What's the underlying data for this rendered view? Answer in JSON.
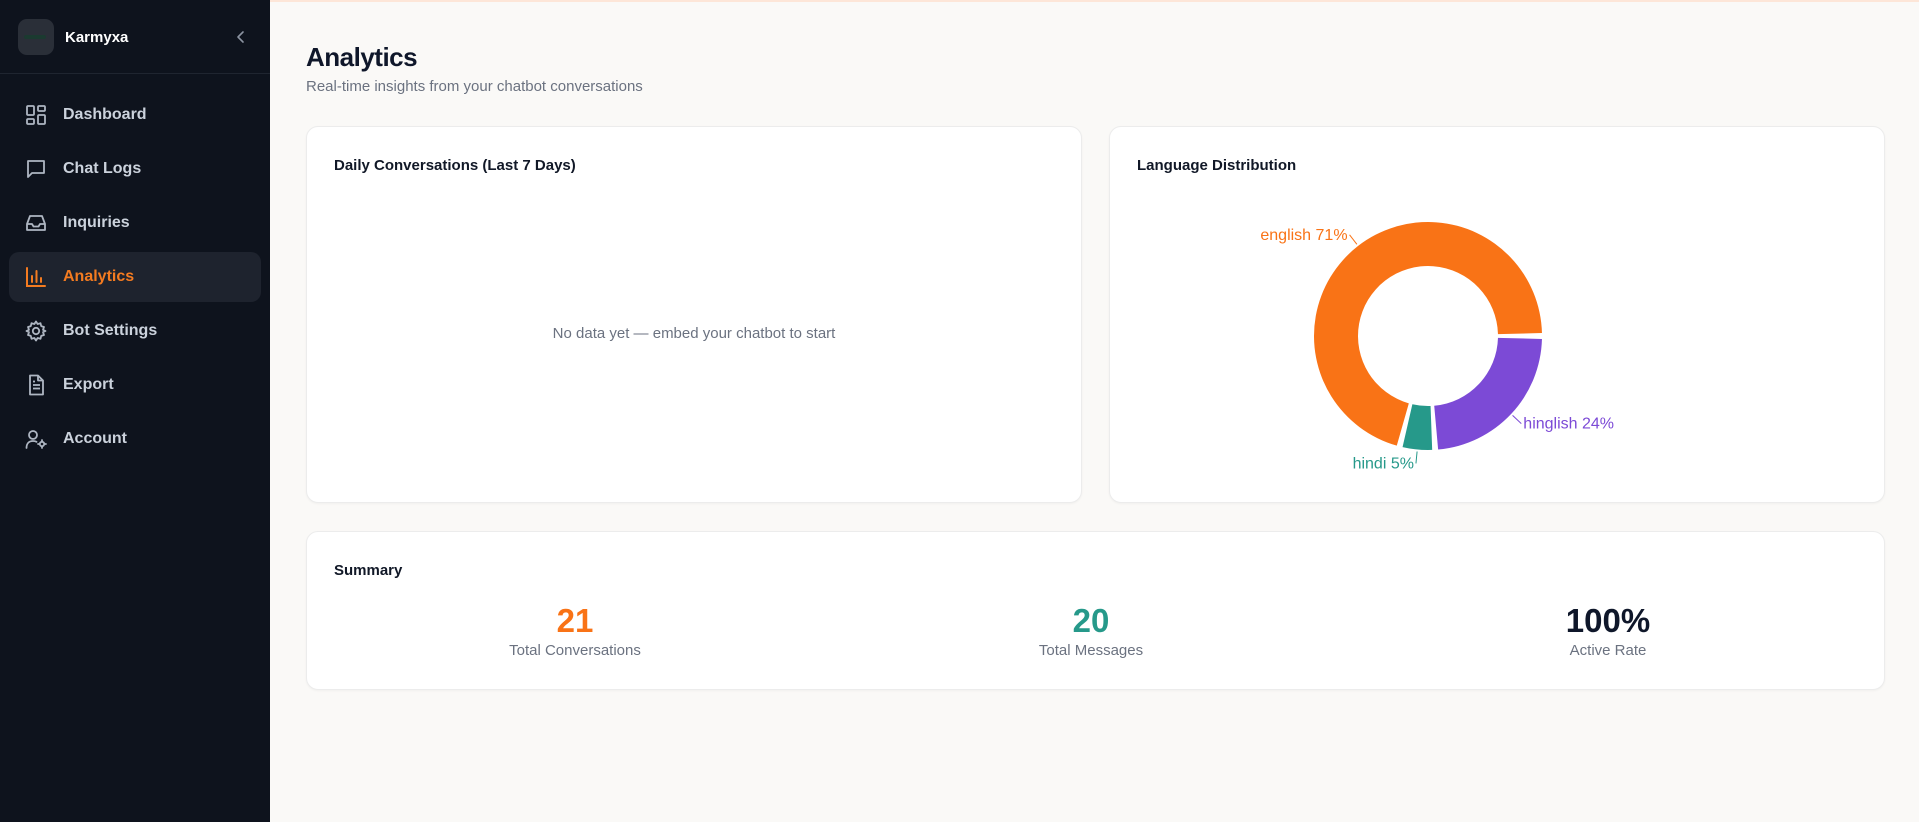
{
  "brand": {
    "name": "Karmyxa"
  },
  "nav": [
    {
      "label": "Dashboard",
      "icon": "dashboard-icon"
    },
    {
      "label": "Chat Logs",
      "icon": "chat-icon"
    },
    {
      "label": "Inquiries",
      "icon": "inbox-icon"
    },
    {
      "label": "Analytics",
      "icon": "bar-chart-icon",
      "active": true
    },
    {
      "label": "Bot Settings",
      "icon": "gear-icon"
    },
    {
      "label": "Export",
      "icon": "file-icon"
    },
    {
      "label": "Account",
      "icon": "user-settings-icon"
    }
  ],
  "header": {
    "title": "Analytics",
    "subtitle": "Real-time insights from your chatbot conversations"
  },
  "daily_card": {
    "title": "Daily Conversations (Last 7 Days)",
    "empty_message": "No data yet — embed your chatbot to start"
  },
  "language_card": {
    "title": "Language Distribution"
  },
  "chart_data": {
    "type": "pie",
    "categories": [
      "english",
      "hinglish",
      "hindi"
    ],
    "values": [
      71,
      24,
      5
    ],
    "labels": [
      "english 71%",
      "hinglish 24%",
      "hindi 5%"
    ],
    "colors": [
      "#f97316",
      "#7c4ad6",
      "#26998a"
    ],
    "donut": true
  },
  "summary": {
    "title": "Summary",
    "stats": [
      {
        "value": "21",
        "label": "Total Conversations",
        "color": "#f97316"
      },
      {
        "value": "20",
        "label": "Total Messages",
        "color": "#26998a"
      },
      {
        "value": "100%",
        "label": "Active Rate",
        "color": "#0f172a"
      }
    ]
  }
}
